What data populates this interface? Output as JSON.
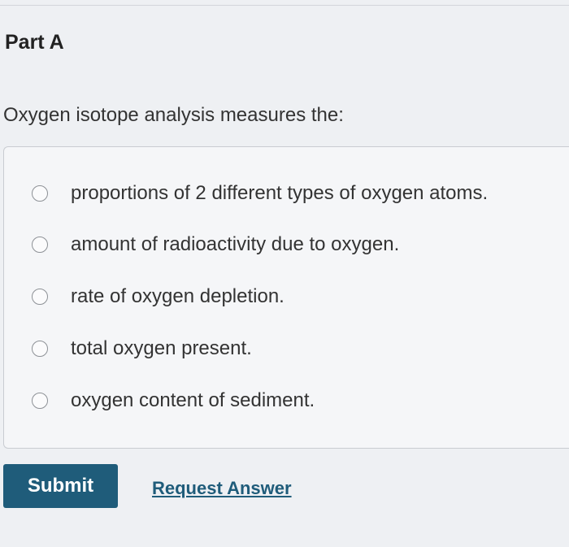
{
  "part": {
    "title": "Part A"
  },
  "question": {
    "text": "Oxygen isotope analysis measures the:"
  },
  "choices": [
    {
      "label": "proportions of 2 different types of oxygen atoms.",
      "selected": false
    },
    {
      "label": "amount of radioactivity due to oxygen.",
      "selected": false
    },
    {
      "label": "rate of oxygen depletion.",
      "selected": false
    },
    {
      "label": "total oxygen present.",
      "selected": false
    },
    {
      "label": "oxygen content of sediment.",
      "selected": false
    }
  ],
  "actions": {
    "submit_label": "Submit",
    "request_answer_label": "Request Answer"
  },
  "colors": {
    "button_background": "#1f5c7a",
    "link": "#1f5c7a"
  }
}
